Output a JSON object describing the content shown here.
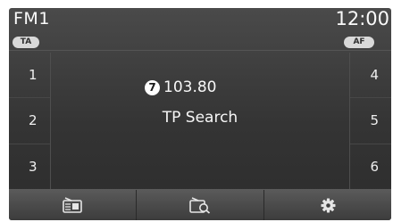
{
  "header": {
    "band": "FM1",
    "time": "12:00"
  },
  "toggles": {
    "ta_label": "TA",
    "af_label": "AF"
  },
  "presets_left": [
    {
      "label": "1"
    },
    {
      "label": "2"
    },
    {
      "label": "3"
    }
  ],
  "presets_right": [
    {
      "label": "4"
    },
    {
      "label": "5"
    },
    {
      "label": "6"
    }
  ],
  "main": {
    "callout_marker": "7",
    "frequency": "103.80",
    "status": "TP Search"
  },
  "bottom_bar": {
    "buttons": [
      {
        "icon": "radio-list-icon"
      },
      {
        "icon": "radio-search-icon"
      },
      {
        "icon": "gear-icon"
      }
    ]
  }
}
